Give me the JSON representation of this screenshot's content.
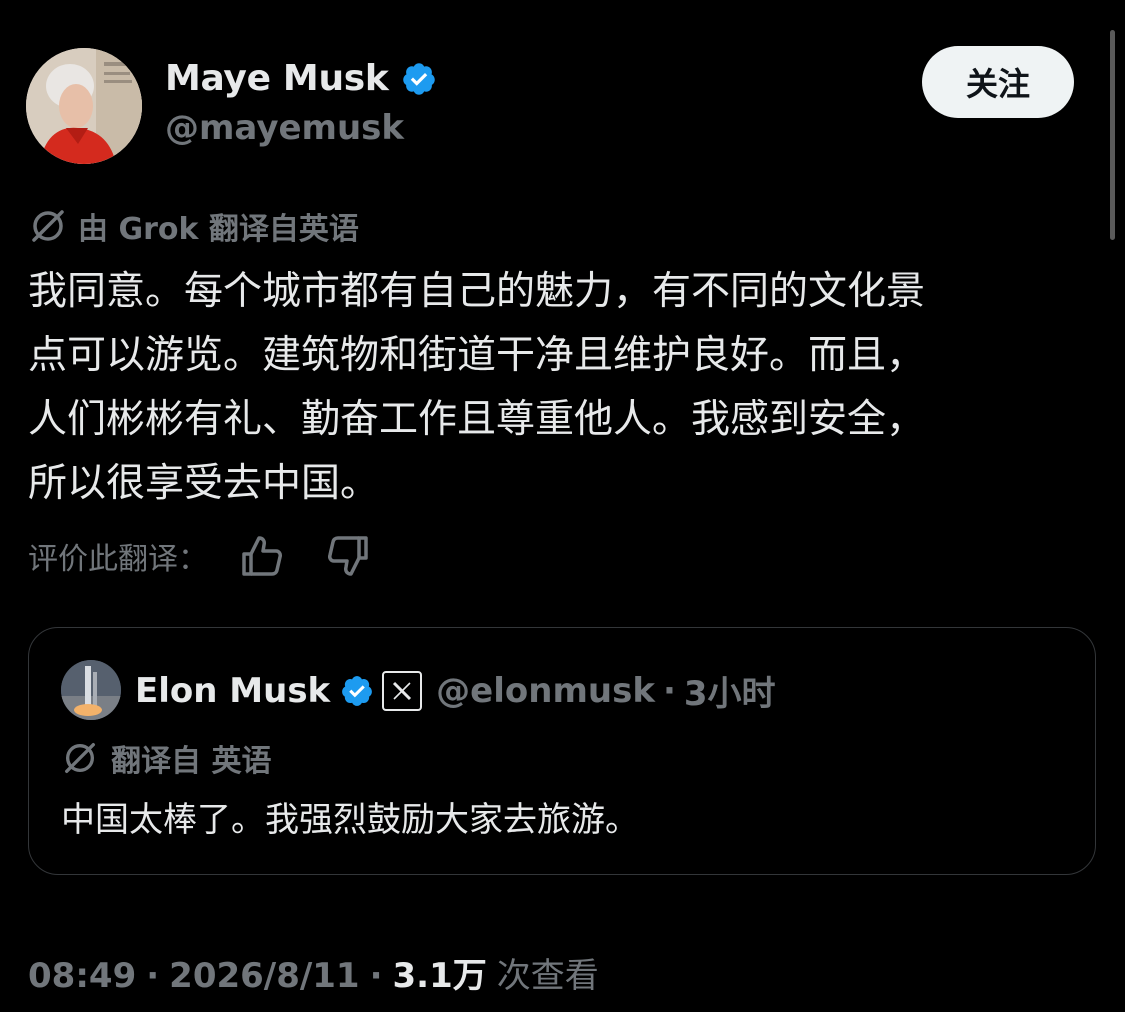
{
  "author": {
    "name": "Maye Musk",
    "handle": "@mayemusk",
    "follow_label": "关注"
  },
  "translation_note": {
    "label": "由 Grok 翻译自英语"
  },
  "tweet": {
    "lines": [
      "我同意。每个城市都有自己的魅力，有不同的文化景",
      "点可以游览。建筑物和街道干净且维护良好。而且，",
      "人们彬彬有礼、勤奋工作且尊重他人。我感到安全，",
      "所以很享受去中国。"
    ]
  },
  "rate": {
    "label": "评价此翻译："
  },
  "quote": {
    "name": "Elon Musk",
    "handle": "@elonmusk",
    "separator": "·",
    "time": "3小时",
    "translate_label": "翻译自 英语",
    "text": "中国太棒了。我强烈鼓励大家去旅游。"
  },
  "footer": {
    "time": "08:49",
    "separator": "·",
    "date": "2026/8/11",
    "views_count": "3.1万",
    "views_label": "次查看"
  },
  "colors": {
    "background": "#000000",
    "text_primary": "#e7e9ea",
    "text_secondary": "#71767b",
    "verified_blue": "#1d9bf0",
    "follow_button_bg": "#eff3f4",
    "card_border": "#333639"
  },
  "icons": {
    "verified": "verified-badge-icon",
    "translate": "translate-slash-icon",
    "thumb_up": "thumb-up-icon",
    "thumb_down": "thumb-down-icon",
    "x_logo": "x-logo-icon"
  }
}
